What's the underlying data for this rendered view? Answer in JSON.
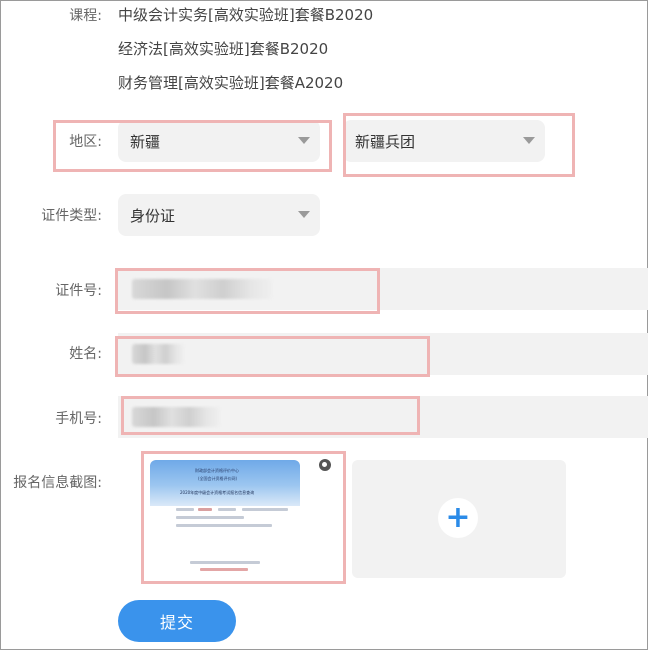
{
  "course": {
    "label": "课程:",
    "items": [
      "中级会计实务[高效实验班]套餐B2020",
      "经济法[高效实验班]套餐B2020",
      "财务管理[高效实验班]套餐A2020"
    ]
  },
  "region": {
    "label": "地区:",
    "province": "新疆",
    "subregion": "新疆兵团"
  },
  "id_type": {
    "label": "证件类型:",
    "value": "身份证"
  },
  "id_number": {
    "label": "证件号:"
  },
  "name": {
    "label": "姓名:"
  },
  "phone": {
    "label": "手机号:"
  },
  "screenshot": {
    "label": "报名信息截图:",
    "thumb_lines": [
      "财政部会计资格评价中心",
      "(全国会计资格评价网)",
      "2020年度中级会计资格考试报名信息查询"
    ],
    "plus_icon": "+"
  },
  "submit": {
    "label": "提交"
  },
  "colors": {
    "highlight": "#efb4b4",
    "accent": "#3a93ec",
    "field_bg": "#f2f2f2"
  }
}
